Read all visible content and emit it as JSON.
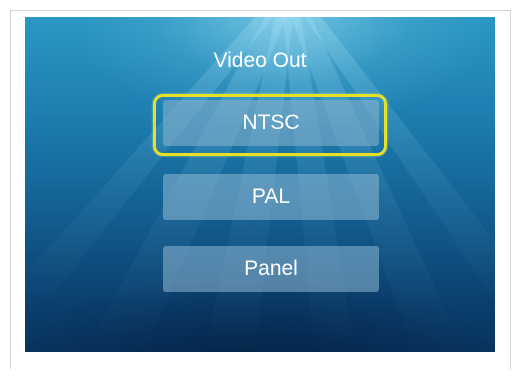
{
  "screen": {
    "title": "Video Out"
  },
  "menu": {
    "items": [
      {
        "label": "NTSC",
        "selected": true
      },
      {
        "label": "PAL",
        "selected": false
      },
      {
        "label": "Panel",
        "selected": false
      }
    ]
  },
  "colors": {
    "selection_outline": "#e8e026",
    "background_top": "#2a97c4",
    "background_bottom": "#083560",
    "button_fill": "#96bed7"
  }
}
